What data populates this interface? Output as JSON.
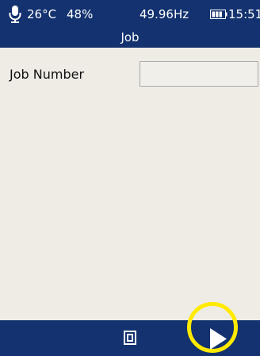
{
  "status": {
    "temperature": "26°C",
    "humidity": "48%",
    "frequency": "49.96Hz",
    "time": "15:51"
  },
  "header": {
    "title": "Job"
  },
  "form": {
    "job_number_label": "Job Number",
    "job_number_value": "",
    "job_number_placeholder": ""
  },
  "icons": {
    "microphone": "microphone-icon",
    "battery": "battery-icon",
    "home": "home-icon",
    "next": "play-arrow-icon"
  },
  "colors": {
    "bar_background": "#13326f",
    "content_background": "#efece6",
    "highlight_ring": "#ffea00"
  }
}
